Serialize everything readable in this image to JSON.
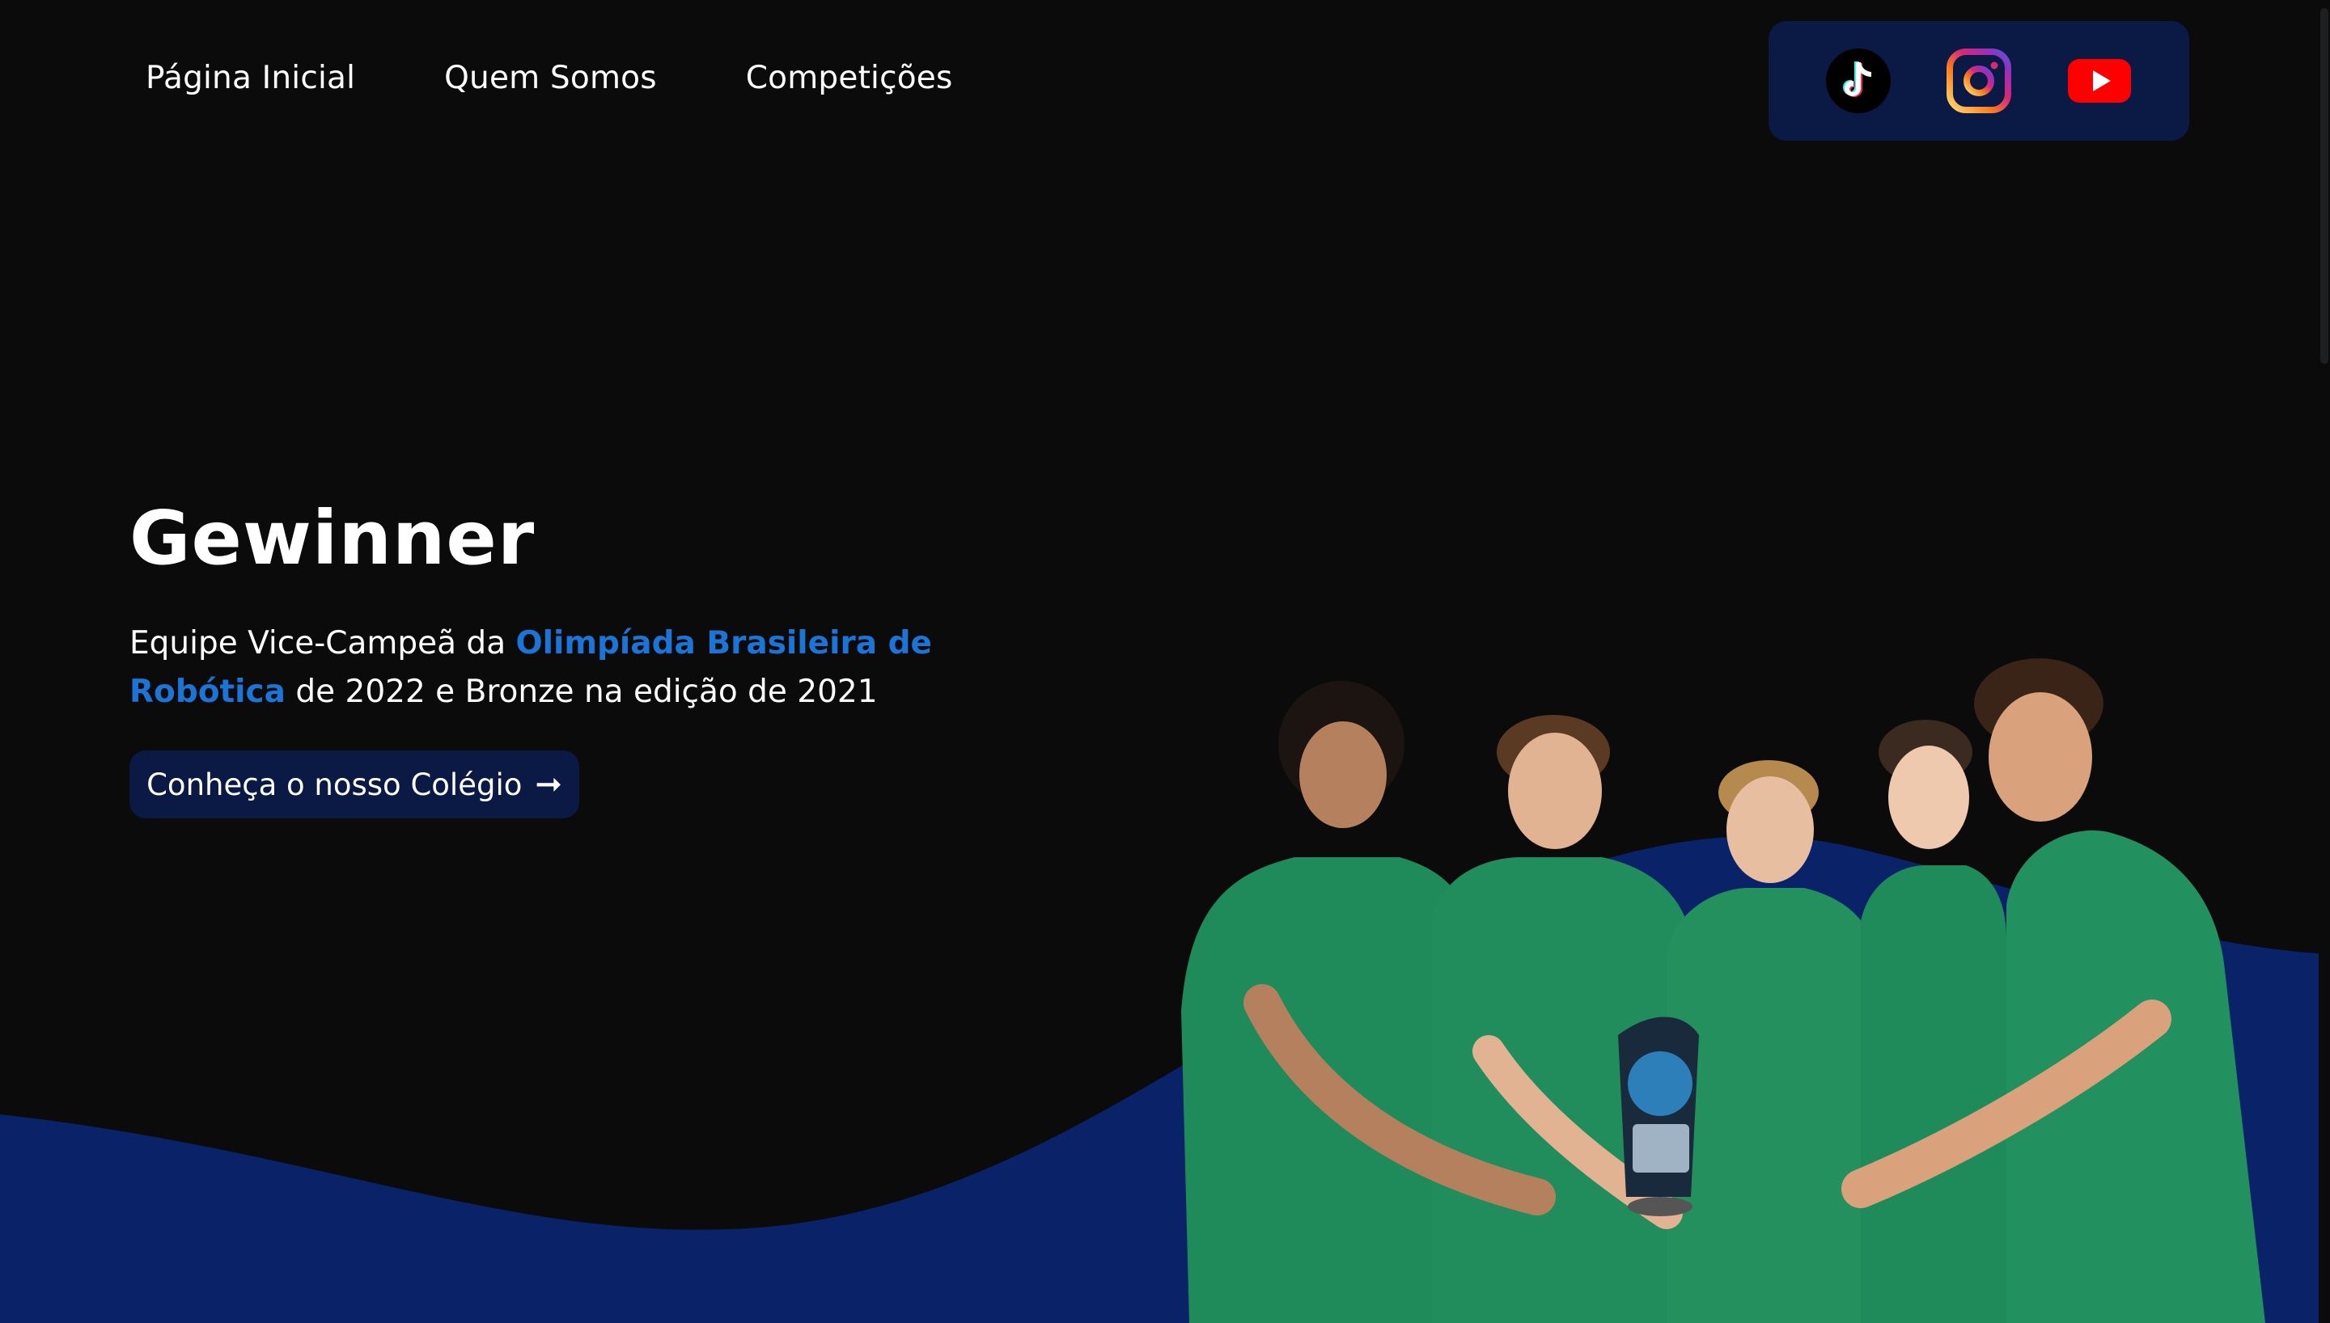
{
  "nav": {
    "items": [
      {
        "label": "Página Inicial"
      },
      {
        "label": "Quem Somos"
      },
      {
        "label": "Competições"
      }
    ]
  },
  "social": [
    {
      "name": "tiktok-icon"
    },
    {
      "name": "instagram-icon"
    },
    {
      "name": "youtube-icon"
    }
  ],
  "hero": {
    "title": "Gewinner",
    "subtitle_part1": "Equipe Vice-Campeã da ",
    "subtitle_highlight": "Olimpíada Brasileira de Robótica",
    "subtitle_part2": " de 2022 e Bronze na edição de 2021",
    "cta_label": "Conheça o nosso Colégio",
    "cta_arrow": "➞"
  },
  "colors": {
    "background": "#0b0b0c",
    "accent": "#1b74d6",
    "panel": "#0b1a45",
    "wave": "#0a2268"
  }
}
